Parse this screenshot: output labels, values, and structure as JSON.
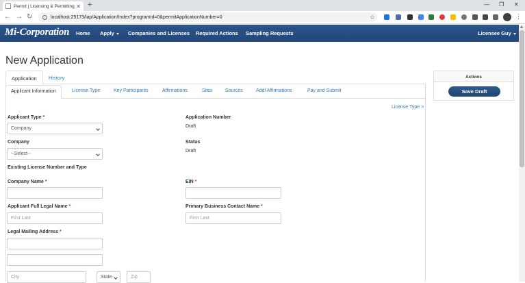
{
  "browser": {
    "tab_title": "Permit | Licensing & Permitting",
    "url": "localhost:25173/lap/Application/Index?programId=0&permitApplicationNumber=0"
  },
  "nav": {
    "brand": "Mi-Corporation",
    "links": [
      "Home",
      "Apply",
      "Companies and Licenses",
      "Required Actions",
      "Sampling Requests"
    ],
    "user": "Licensee Guy"
  },
  "page": {
    "title": "New Application"
  },
  "main_tabs": [
    "Application",
    "History"
  ],
  "sub_tabs": [
    "Applicant Information",
    "License Type",
    "Key Participants",
    "Affirmations",
    "Sites",
    "Sources",
    "Addl Affirmations",
    "Pay and Submit"
  ],
  "next_link": "License Type >",
  "form": {
    "applicant_type_label": "Applicant Type",
    "applicant_type_value": "Company",
    "company_label": "Company",
    "company_value": "--Select--",
    "existing_license_label": "Existing License Number and Type",
    "company_name_label": "Company Name",
    "legal_name_label": "Applicant Full Legal Name",
    "legal_name_placeholder": "First Last",
    "mailing_address_label": "Legal Mailing Address",
    "city_placeholder": "City",
    "state_value": "State",
    "zip_placeholder": "Zip",
    "application_number_label": "Application Number",
    "application_number_value": "Draft",
    "status_label": "Status",
    "status_value": "Draft",
    "ein_label": "EIN",
    "primary_contact_label": "Primary Business Contact Name",
    "primary_contact_placeholder": "First Last",
    "required_mark": "*"
  },
  "actions": {
    "title": "Actions",
    "save_label": "Save Draft"
  }
}
